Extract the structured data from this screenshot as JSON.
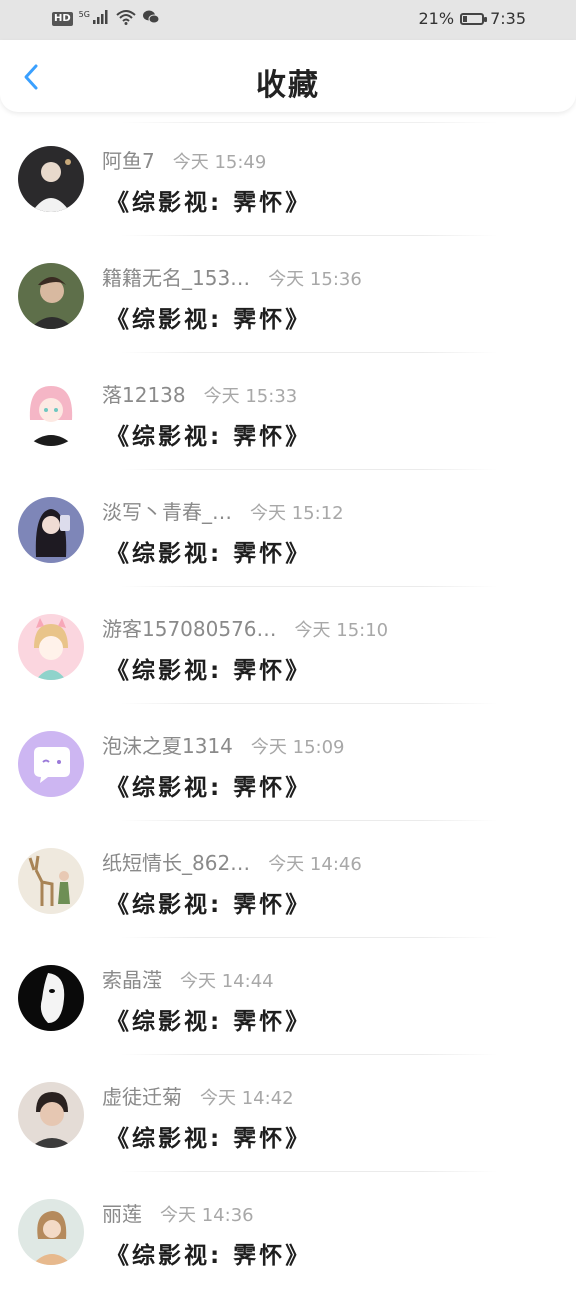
{
  "status_bar": {
    "hd": "HD",
    "network": "5G",
    "battery_text": "21%",
    "battery_level": 0.21,
    "time": "7:35",
    "icons": [
      "signal-icon",
      "wifi-icon",
      "wechat-icon"
    ]
  },
  "header": {
    "title": "收藏",
    "back_icon": "chevron-left-icon",
    "accent": "#3aa0ff"
  },
  "items": [
    {
      "username": "阿鱼7",
      "time": "今天 15:49",
      "title": "《综影视: 霁怀》"
    },
    {
      "username": "籍籍无名_153…",
      "time": "今天 15:36",
      "title": "《综影视: 霁怀》"
    },
    {
      "username": "落12138",
      "time": "今天 15:33",
      "title": "《综影视: 霁怀》"
    },
    {
      "username": "淡写丶青春_…",
      "time": "今天 15:12",
      "title": "《综影视: 霁怀》"
    },
    {
      "username": "游客157080576…",
      "time": "今天 15:10",
      "title": "《综影视: 霁怀》"
    },
    {
      "username": "泡沫之夏1314",
      "time": "今天 15:09",
      "title": "《综影视: 霁怀》"
    },
    {
      "username": "纸短情长_862…",
      "time": "今天 14:46",
      "title": "《综影视: 霁怀》"
    },
    {
      "username": "索晶滢",
      "time": "今天 14:44",
      "title": "《综影视: 霁怀》"
    },
    {
      "username": "虚徒迁菊",
      "time": "今天 14:42",
      "title": "《综影视: 霁怀》"
    },
    {
      "username": "丽莲",
      "time": "今天 14:36",
      "title": "《综影视: 霁怀》"
    }
  ]
}
